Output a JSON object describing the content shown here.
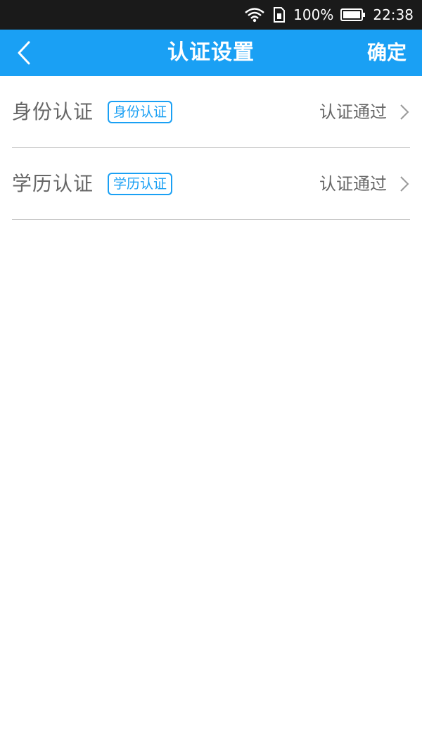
{
  "status_bar": {
    "battery": "100%",
    "time": "22:38",
    "icons": [
      "wifi-icon",
      "sim-icon",
      "battery-icon"
    ]
  },
  "app_bar": {
    "back_icon": "chevron-left-icon",
    "title": "认证设置",
    "confirm_label": "确定",
    "color": "#1aa0f4"
  },
  "items": [
    {
      "label": "身份认证",
      "badge": "身份认证",
      "status": "认证通过",
      "icon": "chevron-right-icon"
    },
    {
      "label": "学历认证",
      "badge": "学历认证",
      "status": "认证通过",
      "icon": "chevron-right-icon"
    }
  ]
}
